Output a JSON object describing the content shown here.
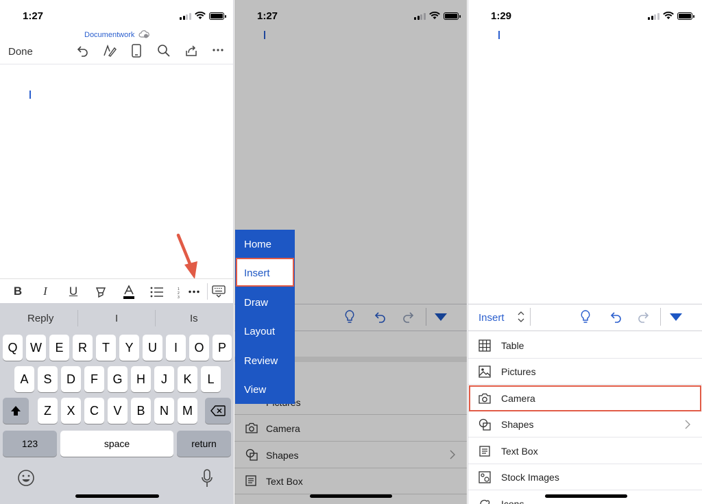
{
  "panel1": {
    "time": "1:27",
    "doc_title": "Documentwork",
    "done_label": "Done",
    "suggestions": [
      "Reply",
      "I",
      "Is"
    ],
    "keyboard": {
      "row1": [
        "Q",
        "W",
        "E",
        "R",
        "T",
        "Y",
        "U",
        "I",
        "O",
        "P"
      ],
      "row2": [
        "A",
        "S",
        "D",
        "F",
        "G",
        "H",
        "J",
        "K",
        "L"
      ],
      "row3": [
        "Z",
        "X",
        "C",
        "V",
        "B",
        "N",
        "M"
      ],
      "numbers_label": "123",
      "space_label": "space",
      "return_label": "return"
    },
    "format_icons": [
      "bold-icon",
      "italic-icon",
      "underline-icon",
      "highlighter-icon",
      "font-color-icon",
      "bullets-icon",
      "numbering-icon",
      "more-icon",
      "keyboard-dismiss-icon"
    ],
    "annotation": "arrow pointing to more button",
    "accent_color": "#e15b46"
  },
  "panel2": {
    "time": "1:27",
    "menu_items": [
      "Home",
      "Insert",
      "Draw",
      "Layout",
      "Review",
      "View"
    ],
    "selected_item": "Insert",
    "list_items": [
      "Pictures",
      "Camera",
      "Shapes",
      "Text Box"
    ],
    "menu_color": "#1d57c4"
  },
  "panel3": {
    "time": "1:29",
    "tab_label": "Insert",
    "items": [
      "Table",
      "Pictures",
      "Camera",
      "Shapes",
      "Text Box",
      "Stock Images",
      "Icons"
    ],
    "highlighted_item": "Camera",
    "accent_color": "#2b5fce"
  }
}
